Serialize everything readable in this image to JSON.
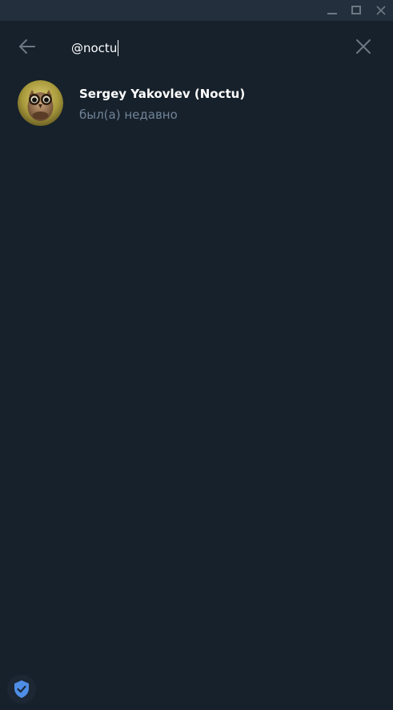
{
  "search": {
    "query": "@noctu"
  },
  "results": [
    {
      "name": "Sergey Yakovlev (Noctu)",
      "status": "был(а) недавно"
    }
  ],
  "colors": {
    "background": "#17212b",
    "titlebar": "#242f3d",
    "accent": "#4e8ee6",
    "status_text": "#708499"
  },
  "icons": {
    "window_minimize": "minimize-icon",
    "window_maximize": "maximize-icon",
    "window_close": "close-icon",
    "back": "arrow-left-icon",
    "clear": "close-icon",
    "security": "shield-check-icon"
  }
}
